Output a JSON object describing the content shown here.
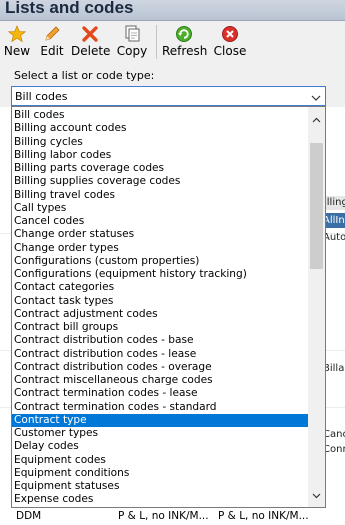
{
  "window": {
    "title": "Lists and codes"
  },
  "toolbar": {
    "new": "New",
    "edit": "Edit",
    "delete": "Delete",
    "copy": "Copy",
    "refresh": "Refresh",
    "close": "Close",
    "icons": {
      "new": "star-icon",
      "edit": "pencil-icon",
      "delete": "red-x-icon",
      "copy": "copy-icon",
      "refresh": "refresh-icon",
      "close": "close-circle-icon"
    }
  },
  "selector": {
    "prompt": "Select a list or code type:",
    "selected_value": "Bill codes"
  },
  "dropdown": {
    "items": [
      "Bill codes",
      "Billing account codes",
      "Billing cycles",
      "Billing labor codes",
      "Billing parts coverage codes",
      "Billing supplies coverage codes",
      "Billing travel codes",
      "Call types",
      "Cancel codes",
      "Change order statuses",
      "Change order types",
      "Configurations (custom properties)",
      "Configurations (equipment history tracking)",
      "Contact categories",
      "Contact task types",
      "Contract adjustment codes",
      "Contract bill groups",
      "Contract distribution codes - base",
      "Contract distribution codes - lease",
      "Contract distribution codes - overage",
      "Contract miscellaneous charge codes",
      "Contract termination codes - lease",
      "Contract termination codes - standard",
      "Contract type",
      "Customer types",
      "Delay codes",
      "Equipment codes",
      "Equipment conditions",
      "Equipment statuses",
      "Expense codes"
    ],
    "highlighted_item": "Contract type"
  },
  "background_grid": {
    "header_fragment": "illing",
    "row_fragments": [
      "AllIn",
      "Auto",
      "Billab",
      "Canc",
      "Conr"
    ]
  },
  "bottom_row": {
    "code": "DDM",
    "col1": "P & L, no INK/M...",
    "col2": "P & L, no INK/M..."
  },
  "colors": {
    "selection": "#0078d7",
    "title_bar": "#c4ccd8",
    "focus_border": "#3c7fd1"
  }
}
